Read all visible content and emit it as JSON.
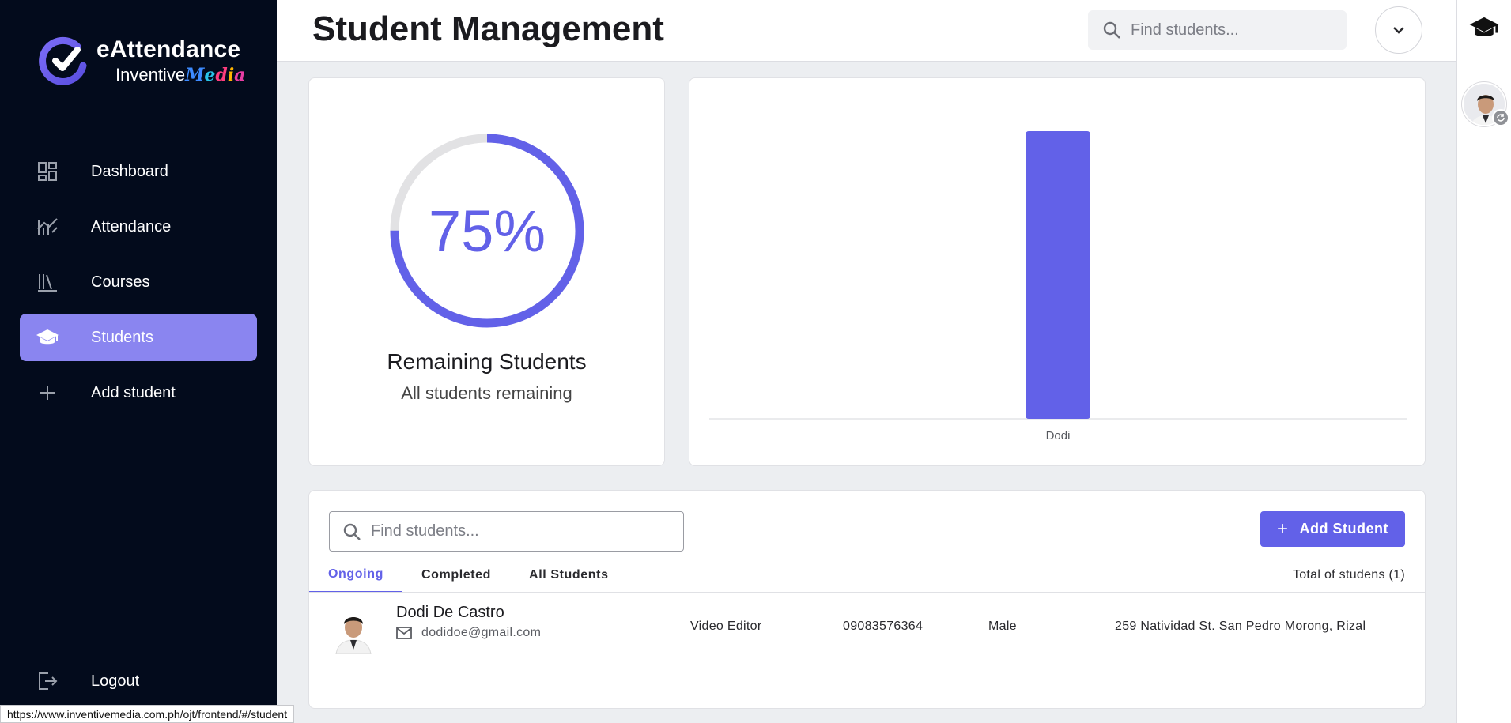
{
  "brand": {
    "title": "eAttendance",
    "sub_prefix": "Inventive",
    "sub_accent": "Media"
  },
  "sidebar": {
    "items": [
      {
        "label": "Dashboard",
        "icon": "dashboard-icon"
      },
      {
        "label": "Attendance",
        "icon": "chart-line-icon"
      },
      {
        "label": "Courses",
        "icon": "books-icon"
      },
      {
        "label": "Students",
        "icon": "graduation-cap-icon",
        "active": true
      },
      {
        "label": "Add student",
        "icon": "plus-icon"
      }
    ],
    "logout": "Logout"
  },
  "header": {
    "title": "Student Management",
    "search_placeholder": "Find students..."
  },
  "progress": {
    "value_text": "75%",
    "percent": 75,
    "title": "Remaining Students",
    "subtitle": "All students remaining"
  },
  "chart_data": {
    "type": "bar",
    "categories": [
      "Dodi"
    ],
    "values": [
      1
    ],
    "ylim": [
      0,
      1
    ],
    "title": "",
    "xlabel": "",
    "ylabel": "",
    "color": "#6261e8",
    "grid": false
  },
  "table": {
    "search_placeholder": "Find students...",
    "add_button": "Add Student",
    "tabs": [
      "Ongoing",
      "Completed",
      "All Students"
    ],
    "active_tab": "Ongoing",
    "total_text": "Total of studens (1)",
    "rows": [
      {
        "name": "Dodi De Castro",
        "email": "dodidoe@gmail.com",
        "role": "Video Editor",
        "phone": "09083576364",
        "gender": "Male",
        "address": "259 Natividad St. San Pedro Morong, Rizal"
      }
    ]
  },
  "statusbar": {
    "url": "https://www.inventivemedia.com.ph/ojt/frontend/#/student"
  },
  "colors": {
    "accent": "#6261e8",
    "sidebar_bg": "#030b1c",
    "active_nav": "#8a85f0"
  }
}
